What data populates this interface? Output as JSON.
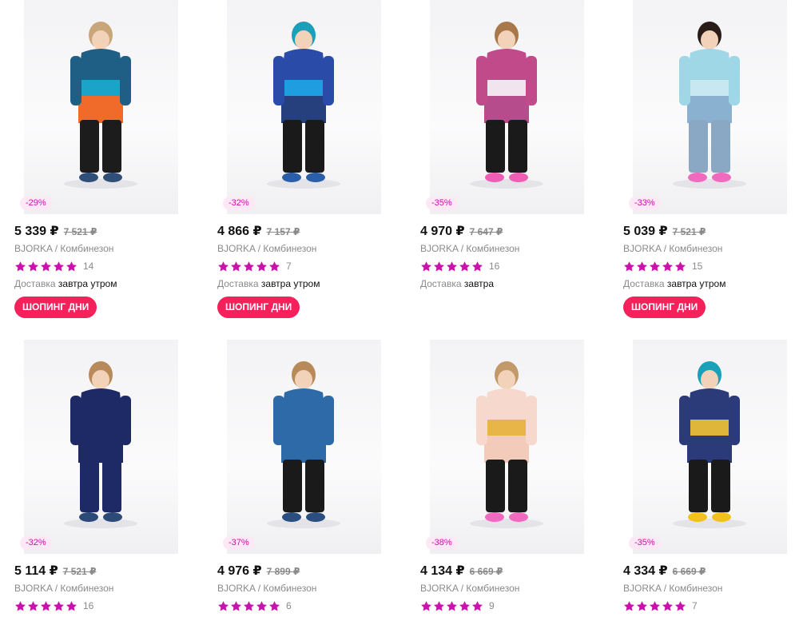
{
  "products": [
    {
      "discount": "-29%",
      "price": "5 339 ₽",
      "old_price": "7 521 ₽",
      "brand": "BJORKA",
      "category": "Комбинезон",
      "rating_stars": 5,
      "reviews": "14",
      "delivery_label": "Доставка",
      "delivery_when": "завтра утром",
      "promo_label": "ШОПИНГ ДНИ",
      "colors": {
        "hat": "#c9a57a",
        "top": "#1f5f86",
        "mid": "#1ba3c8",
        "bottom": "#f06a2a",
        "legs": "#1c1c1c",
        "boots": "#2f4e78"
      }
    },
    {
      "discount": "-32%",
      "price": "4 866 ₽",
      "old_price": "7 157 ₽",
      "brand": "BJORKA",
      "category": "Комбинезон",
      "rating_stars": 5,
      "reviews": "7",
      "delivery_label": "Доставка",
      "delivery_when": "завтра утром",
      "promo_label": "ШОПИНГ ДНИ",
      "colors": {
        "hat": "#1aa0b8",
        "top": "#2b4ba8",
        "mid": "#1e9ee0",
        "bottom": "#26407e",
        "legs": "#1a1a1a",
        "boots": "#2a5ea8"
      }
    },
    {
      "discount": "-35%",
      "price": "4 970 ₽",
      "old_price": "7 647 ₽",
      "brand": "BJORKA",
      "category": "Комбинезон",
      "rating_stars": 5,
      "reviews": "16",
      "delivery_label": "Доставка",
      "delivery_when": "завтра",
      "promo_label": "",
      "colors": {
        "hat": "#a8784a",
        "top": "#c04a8a",
        "mid": "#f1e4ef",
        "bottom": "#b64c8c",
        "legs": "#1a1a1a",
        "boots": "#f05db4"
      }
    },
    {
      "discount": "-33%",
      "price": "5 039 ₽",
      "old_price": "7 521 ₽",
      "brand": "BJORKA",
      "category": "Комбинезон",
      "rating_stars": 5,
      "reviews": "15",
      "delivery_label": "Доставка",
      "delivery_when": "завтра утром",
      "promo_label": "ШОПИНГ ДНИ",
      "colors": {
        "hat": "#2a1c18",
        "top": "#9fd7e6",
        "mid": "#c7e8f0",
        "bottom": "#8ab1cf",
        "legs": "#8aa7c3",
        "boots": "#f06ac0"
      }
    },
    {
      "discount": "-32%",
      "price": "5 114 ₽",
      "old_price": "7 521 ₽",
      "brand": "BJORKA",
      "category": "Комбинезон",
      "rating_stars": 5,
      "reviews": "16",
      "delivery_label": "",
      "delivery_when": "",
      "promo_label": "",
      "colors": {
        "hat": "#b88a5a",
        "top": "#1e2a66",
        "mid": "#1e2a66",
        "bottom": "#1e2a66",
        "legs": "#1e2a66",
        "boots": "#2c4a78"
      }
    },
    {
      "discount": "-37%",
      "price": "4 976 ₽",
      "old_price": "7 899 ₽",
      "brand": "BJORKA",
      "category": "Комбинезон",
      "rating_stars": 5,
      "reviews": "6",
      "delivery_label": "",
      "delivery_when": "",
      "promo_label": "",
      "colors": {
        "hat": "#b88a5a",
        "top": "#2f6aa8",
        "mid": "#2f6aa8",
        "bottom": "#2f6aa8",
        "legs": "#1a1a1a",
        "boots": "#2a4e80"
      }
    },
    {
      "discount": "-38%",
      "price": "4 134 ₽",
      "old_price": "6 669 ₽",
      "brand": "BJORKA",
      "category": "Комбинезон",
      "rating_stars": 5,
      "reviews": "9",
      "delivery_label": "",
      "delivery_when": "",
      "promo_label": "",
      "colors": {
        "hat": "#c29a6a",
        "top": "#f6d9cc",
        "mid": "#e7b548",
        "bottom": "#f2cbbb",
        "legs": "#1a1a1a",
        "boots": "#f06ac0"
      }
    },
    {
      "discount": "-35%",
      "price": "4 334 ₽",
      "old_price": "6 669 ₽",
      "brand": "BJORKA",
      "category": "Комбинезон",
      "rating_stars": 5,
      "reviews": "7",
      "delivery_label": "",
      "delivery_when": "",
      "promo_label": "",
      "colors": {
        "hat": "#1aa0b8",
        "top": "#2b3b7a",
        "mid": "#e0b63a",
        "bottom": "#2b3b7a",
        "legs": "#1a1a1a",
        "boots": "#f2c21a"
      }
    }
  ],
  "star_color": "#cb11ab"
}
